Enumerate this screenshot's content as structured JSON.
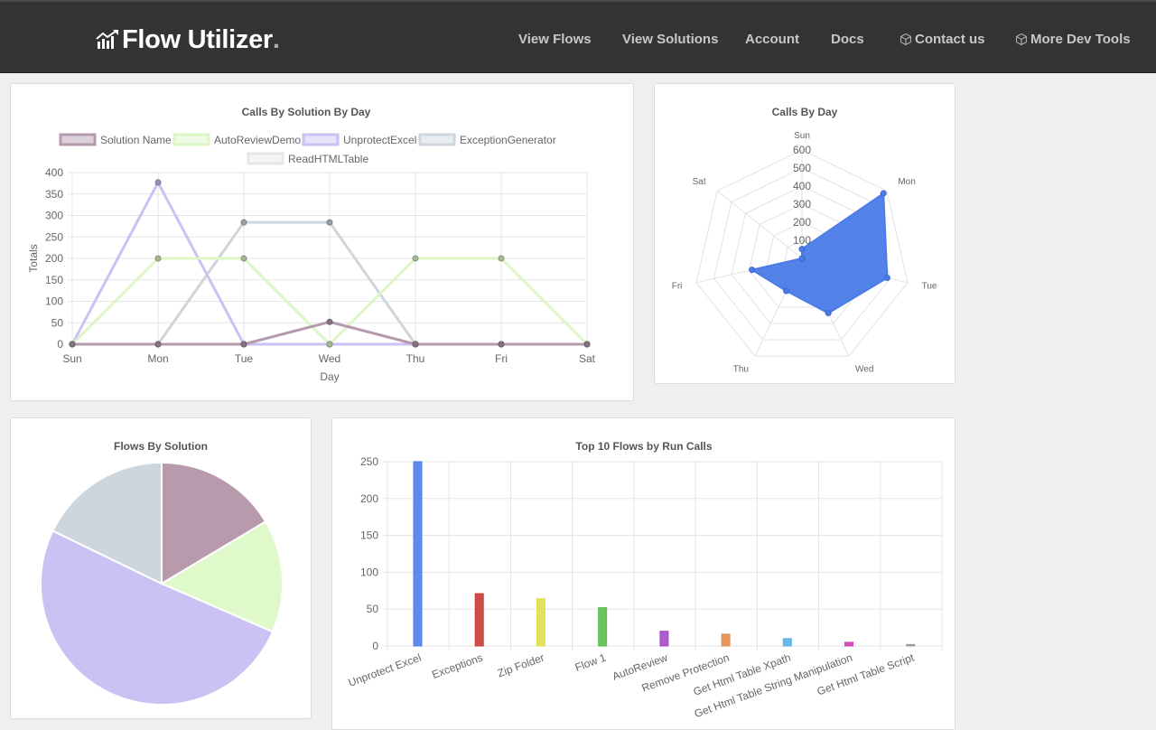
{
  "brand": {
    "name": "Flow Utilizer",
    "dot": "."
  },
  "nav": {
    "view_flows": "View Flows",
    "view_solutions": "View Solutions",
    "account": "Account",
    "docs": "Docs",
    "contact": "Contact us",
    "dev_tools": "More Dev Tools"
  },
  "chart_data": [
    {
      "type": "line",
      "title": "Calls By Solution By Day",
      "xlabel": "Day",
      "ylabel": "Totals",
      "categories": [
        "Sun",
        "Mon",
        "Tue",
        "Wed",
        "Thu",
        "Fri",
        "Sat"
      ],
      "ylim": [
        0,
        400
      ],
      "yticks": [
        0,
        50,
        100,
        150,
        200,
        250,
        300,
        350,
        400
      ],
      "legend_position": "top",
      "grid": true,
      "series": [
        {
          "name": "Solution Name",
          "color": "#b39aac",
          "values": [
            0,
            0,
            0,
            52,
            0,
            0,
            0
          ]
        },
        {
          "name": "AutoReviewDemo",
          "color": "#dcf7c6",
          "values": [
            0,
            200,
            200,
            0,
            200,
            200,
            0
          ]
        },
        {
          "name": "UnprotectExcel",
          "color": "#c9c2f2",
          "values": [
            0,
            377,
            0,
            0,
            0,
            0,
            0
          ]
        },
        {
          "name": "ExceptionGenerator",
          "color": "#cdd6dc",
          "values": [
            0,
            0,
            284,
            284,
            0,
            0,
            0
          ]
        },
        {
          "name": "ReadHTMLTable",
          "color": "#e6e6e6",
          "values": [
            0,
            0,
            0,
            0,
            0,
            0,
            0
          ]
        }
      ]
    },
    {
      "type": "radar",
      "title": "Calls By Day",
      "categories": [
        "Sun",
        "Mon",
        "Tue",
        "Wed",
        "Thu",
        "Fri",
        "Sat"
      ],
      "rlim": [
        0,
        600
      ],
      "rticks": [
        100,
        200,
        300,
        400,
        500,
        600
      ],
      "color": "#4a7be8",
      "values": [
        52,
        577,
        484,
        336,
        200,
        284,
        0
      ]
    },
    {
      "type": "pie",
      "title": "Flows By Solution",
      "slices": [
        {
          "color": "#b89aad",
          "value": 12
        },
        {
          "color": "#dff9cb",
          "value": 11
        },
        {
          "color": "#c9c2f3",
          "value": 37
        },
        {
          "color": "#cdd6dc",
          "value": 13
        }
      ]
    },
    {
      "type": "bar",
      "title": "Top 10 Flows by Run Calls",
      "ylim": [
        0,
        250
      ],
      "yticks": [
        0,
        50,
        100,
        150,
        200,
        250
      ],
      "categories": [
        "Unprotect Excel",
        "Exceptions",
        "Zip Folder",
        "Flow 1",
        "AutoReview",
        "Remove Protection",
        "Get Html Table Xpath",
        "Get Html Table String Manipulation",
        "Get Html Table Script"
      ],
      "values": [
        250,
        71,
        64,
        52,
        20,
        16,
        10,
        5,
        2
      ],
      "colors": [
        "#4f7ee8",
        "#c93a36",
        "#e2de49",
        "#59c04d",
        "#a449c8",
        "#e48c4e",
        "#5aaee6",
        "#cf3fb6",
        "#999999"
      ]
    }
  ]
}
